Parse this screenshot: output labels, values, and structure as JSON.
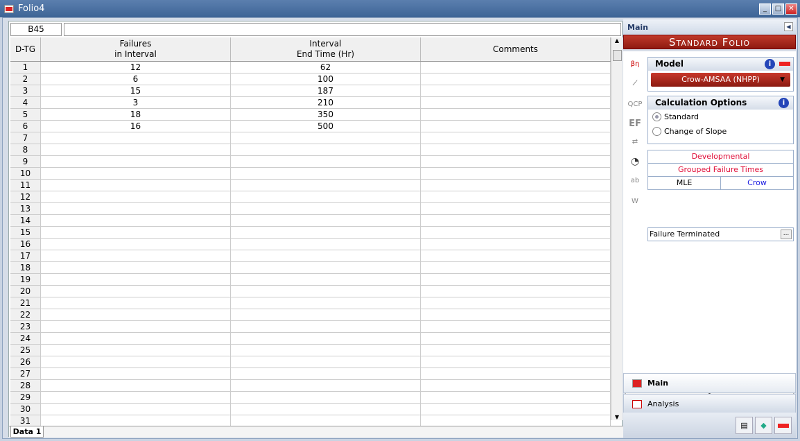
{
  "window": {
    "title": "Folio4",
    "minimize": "_",
    "maximize": "□",
    "close": "✕"
  },
  "sheet": {
    "cell_ref": "B45",
    "formula": "",
    "columns": [
      "D-TG",
      "Failures\nin Interval",
      "Interval\nEnd Time (Hr)",
      "Comments"
    ],
    "rows": [
      [
        "1",
        "12",
        "62",
        ""
      ],
      [
        "2",
        "6",
        "100",
        ""
      ],
      [
        "3",
        "15",
        "187",
        ""
      ],
      [
        "4",
        "3",
        "210",
        ""
      ],
      [
        "5",
        "18",
        "350",
        ""
      ],
      [
        "6",
        "16",
        "500",
        ""
      ],
      [
        "7",
        "",
        "",
        ""
      ],
      [
        "8",
        "",
        "",
        ""
      ],
      [
        "9",
        "",
        "",
        ""
      ],
      [
        "10",
        "",
        "",
        ""
      ],
      [
        "11",
        "",
        "",
        ""
      ],
      [
        "12",
        "",
        "",
        ""
      ],
      [
        "13",
        "",
        "",
        ""
      ],
      [
        "14",
        "",
        "",
        ""
      ],
      [
        "15",
        "",
        "",
        ""
      ],
      [
        "16",
        "",
        "",
        ""
      ],
      [
        "17",
        "",
        "",
        ""
      ],
      [
        "18",
        "",
        "",
        ""
      ],
      [
        "19",
        "",
        "",
        ""
      ],
      [
        "20",
        "",
        "",
        ""
      ],
      [
        "21",
        "",
        "",
        ""
      ],
      [
        "22",
        "",
        "",
        ""
      ],
      [
        "23",
        "",
        "",
        ""
      ],
      [
        "24",
        "",
        "",
        ""
      ],
      [
        "25",
        "",
        "",
        ""
      ],
      [
        "26",
        "",
        "",
        ""
      ],
      [
        "27",
        "",
        "",
        ""
      ],
      [
        "28",
        "",
        "",
        ""
      ],
      [
        "29",
        "",
        "",
        ""
      ],
      [
        "30",
        "",
        "",
        ""
      ],
      [
        "31",
        "",
        "",
        ""
      ]
    ],
    "tabs": [
      "Data 1"
    ]
  },
  "panel": {
    "header": "Main",
    "banner": "Standard Folio",
    "model": {
      "title": "Model",
      "value": "Crow-AMSAA (NHPP)"
    },
    "calc": {
      "title": "Calculation Options",
      "options": [
        "Standard",
        "Change of Slope"
      ],
      "selected": "Standard"
    },
    "info": {
      "type": "Developmental",
      "data": "Grouped Failure Times",
      "method": "MLE",
      "variant": "Crow"
    },
    "termination": "Failure Terminated",
    "side_icons": [
      "beta-eta-sigma-mu-icon",
      "plot-icon",
      "qcp-icon",
      "ef-icon",
      "convert-icon",
      "gauge-icon",
      "abc-icon",
      "weibull-icon"
    ],
    "nav": [
      "Main",
      "Analysis"
    ]
  },
  "colors": {
    "accent": "#b02a1c",
    "title_bar": "#4a6fa0",
    "info_red": "#e0103a",
    "crow_blue": "#1a1ae0"
  }
}
